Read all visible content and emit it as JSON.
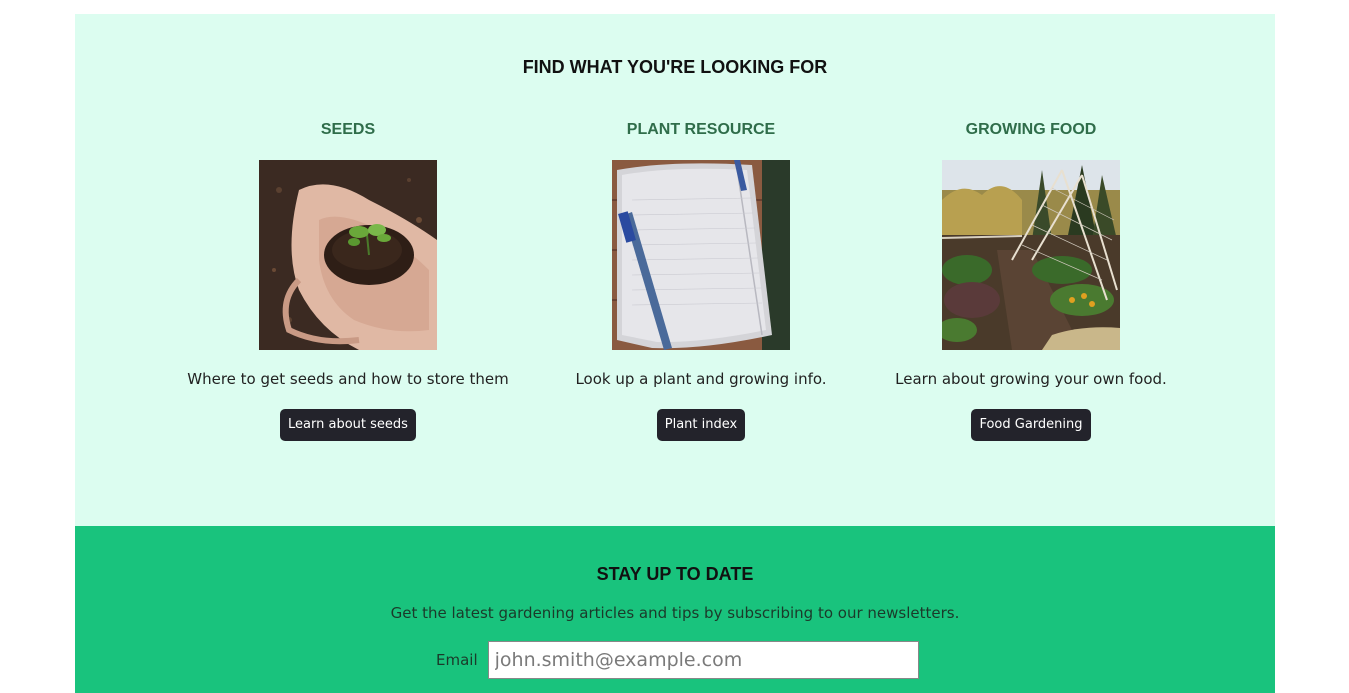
{
  "find_section": {
    "title": "FIND WHAT YOU'RE LOOKING FOR",
    "cards": [
      {
        "title": "SEEDS",
        "image_icon": "hands-seedling-image",
        "description": "Where to get seeds and how to store them",
        "button_label": "Learn about seeds"
      },
      {
        "title": "PLANT RESOURCE",
        "image_icon": "notebook-pen-image",
        "description": "Look up a plant and growing info.",
        "button_label": "Plant index"
      },
      {
        "title": "GROWING FOOD",
        "image_icon": "vegetable-garden-image",
        "description": "Learn about growing your own food.",
        "button_label": "Food Gardening"
      }
    ]
  },
  "newsletter": {
    "title": "STAY UP TO DATE",
    "description": "Get the latest gardening articles and tips by subscribing to our newsletters.",
    "email_label": "Email",
    "email_placeholder": "john.smith@example.com",
    "email_value": ""
  },
  "colors": {
    "find_background": "#dcfdf0",
    "newsletter_background": "#19c37d",
    "card_title": "#2f6d4a",
    "button_background": "#23232b"
  }
}
